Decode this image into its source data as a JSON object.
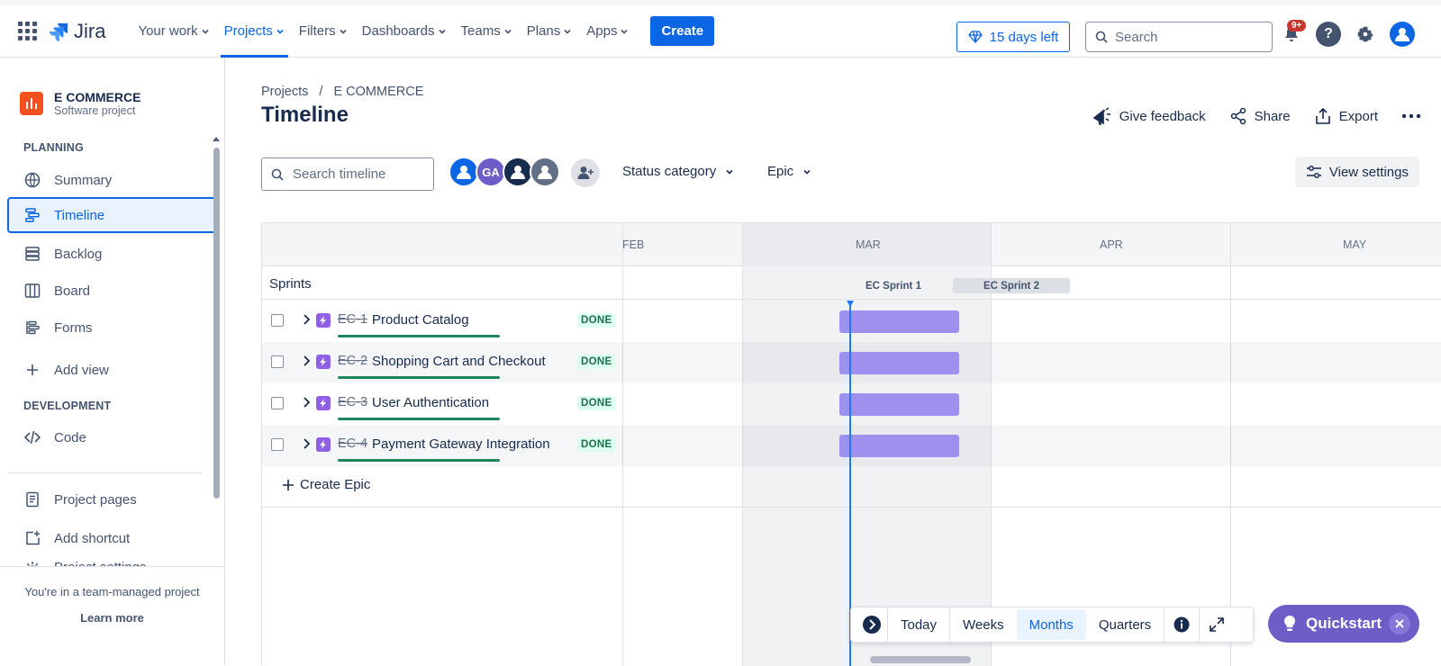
{
  "topbar": {
    "logo_text": "Jira",
    "nav": [
      {
        "label": "Your work",
        "active": false
      },
      {
        "label": "Projects",
        "active": true
      },
      {
        "label": "Filters",
        "active": false
      },
      {
        "label": "Dashboards",
        "active": false
      },
      {
        "label": "Teams",
        "active": false
      },
      {
        "label": "Plans",
        "active": false
      },
      {
        "label": "Apps",
        "active": false
      }
    ],
    "create_label": "Create",
    "trial_label": "15 days left",
    "search_placeholder": "Search",
    "notification_count": "9+"
  },
  "sidebar": {
    "project_name": "E COMMERCE",
    "project_type": "Software project",
    "planning_label": "PLANNING",
    "planning_items": [
      "Summary",
      "Timeline",
      "Backlog",
      "Board",
      "Forms"
    ],
    "active_item": "Timeline",
    "add_view": "Add view",
    "development_label": "DEVELOPMENT",
    "code": "Code",
    "project_pages": "Project pages",
    "add_shortcut": "Add shortcut",
    "project_settings": "Project settings",
    "footer_text": "You're in a team-managed project",
    "learn_more": "Learn more"
  },
  "main": {
    "breadcrumb_projects": "Projects",
    "breadcrumb_sep": "/",
    "breadcrumb_project": "E COMMERCE",
    "title": "Timeline",
    "actions": {
      "feedback": "Give feedback",
      "share": "Share",
      "export": "Export"
    },
    "timeline_search_placeholder": "Search timeline",
    "avatar_initials": "GA",
    "filters": {
      "status": "Status category",
      "epic": "Epic"
    },
    "view_settings": "View settings"
  },
  "timeline": {
    "months": [
      "FEB",
      "MAR",
      "APR",
      "MAY"
    ],
    "sprints_label": "Sprints",
    "sprints": [
      "EC Sprint 1",
      "EC Sprint 2"
    ],
    "epics": [
      {
        "key": "EC-1",
        "summary": "Product Catalog",
        "status": "DONE"
      },
      {
        "key": "EC-2",
        "summary": "Shopping Cart and Checkout",
        "status": "DONE"
      },
      {
        "key": "EC-3",
        "summary": "User Authentication",
        "status": "DONE"
      },
      {
        "key": "EC-4",
        "summary": "Payment Gateway Integration",
        "status": "DONE"
      }
    ],
    "create_epic": "Create Epic"
  },
  "zoom": {
    "today": "Today",
    "weeks": "Weeks",
    "months": "Months",
    "quarters": "Quarters",
    "selected": "Months"
  },
  "quickstart": "Quickstart",
  "colors": {
    "brand": "#0c66e4",
    "epic": "#8f5fe8",
    "bar": "#9f8fef",
    "done_text": "#216e4e",
    "today": "#1d7afc"
  }
}
